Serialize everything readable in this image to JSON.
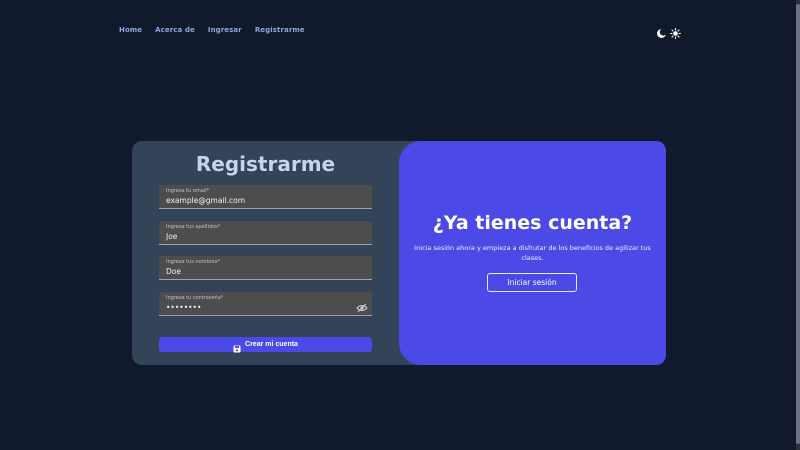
{
  "nav": {
    "items": [
      {
        "label": "Home"
      },
      {
        "label": "Acerca de"
      },
      {
        "label": "Ingresar"
      },
      {
        "label": "Registrarme"
      }
    ]
  },
  "theme": {
    "dark_icon": "moon-icon",
    "light_icon": "sun-icon"
  },
  "register": {
    "title": "Registrarme",
    "fields": [
      {
        "label": "Ingresa tu email*",
        "value": "example@gmail.com"
      },
      {
        "label": "Ingresa tus apellidos*",
        "value": "Joe"
      },
      {
        "label": "Ingresa tus nombres*",
        "value": "Doe"
      },
      {
        "label": "Ingresa tu contraseña*",
        "value": "••••••••",
        "icon": "eye-off-icon"
      }
    ],
    "submit_label": "Crear mi cuenta",
    "submit_icon": "save-icon"
  },
  "login_panel": {
    "title": "¿Ya tienes cuenta?",
    "text": "Inicia sesión ahora y empieza a disfrutar de los beneficios de agilizar tus clases.",
    "button_label": "Iniciar sesión"
  },
  "colors": {
    "background": "#101a2c",
    "card": "#344458",
    "accent": "#4b4ae6",
    "nav_link": "#8fa6dc"
  }
}
